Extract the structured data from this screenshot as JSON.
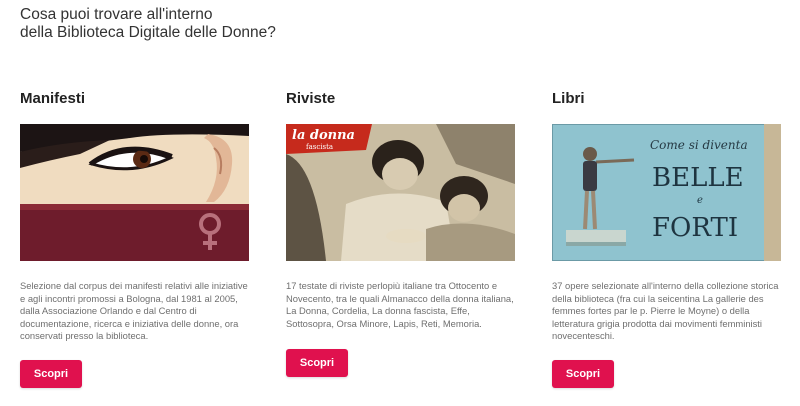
{
  "heading": {
    "line1": "Cosa puoi trovare all'interno",
    "line2": "della Biblioteca Digitale delle Donne?"
  },
  "cards": [
    {
      "title": "Manifesti",
      "image_icon": "female-symbol-icon",
      "description": "Selezione dal corpus dei manifesti relativi alle iniziative e agli incontri promossi a Bologna, dal 1981 al 2005, dalla Associazione Orlando e dal Centro di documentazione, ricerca e iniziativa delle donne, ora conservati presso la biblioteca.",
      "button_label": "Scopri"
    },
    {
      "title": "Riviste",
      "image_text": "la donna",
      "image_subtext": "fascista",
      "description": "17 testate di riviste perlopiù italiane tra Ottocento e Novecento, tra le quali Almanacco della donna italiana, La Donna, Cordelia, La donna fascista, Effe, Sottosopra, Orsa Minore, Lapis, Reti, Memoria.",
      "button_label": "Scopri"
    },
    {
      "title": "Libri",
      "image_text_top": "Come si diventa",
      "image_text_big1": "BELLE",
      "image_text_small": "e",
      "image_text_big2": "FORTI",
      "description": "37 opere selezionate all'interno della collezione storica della biblioteca (fra cui la seicentina La gallerie des femmes fortes par le p. Pierre le Moyne) o della letteratura grigia prodotta dai movimenti femministi novecenteschi.",
      "button_label": "Scopri"
    }
  ],
  "colors": {
    "accent": "#e0114e",
    "poster_maroon": "#6e1c2c",
    "book_blue": "#8fc3cf"
  }
}
